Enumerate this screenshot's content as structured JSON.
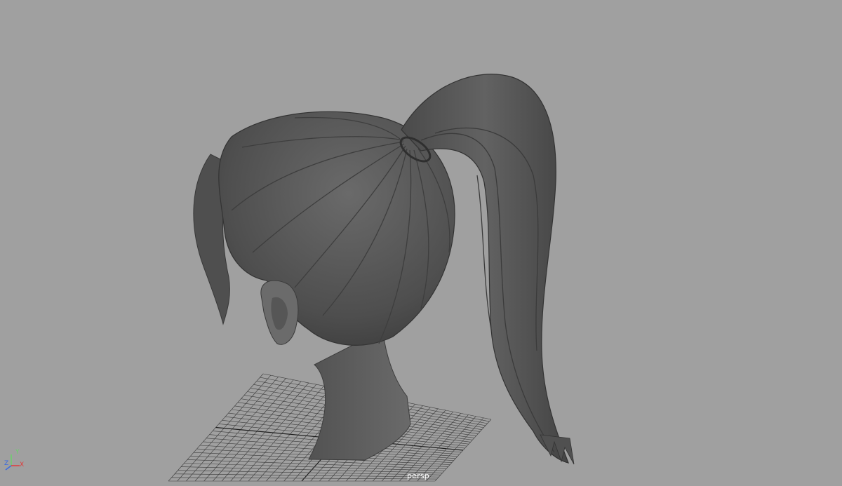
{
  "viewport": {
    "camera_name": "persp",
    "background_color": "#a0a0a0"
  },
  "axis_gizmo": {
    "x_label": "X",
    "y_label": "Y",
    "z_label": "Z",
    "x_color": "#e03a3a",
    "y_color": "#6ad16a",
    "z_color": "#3a6ae0"
  },
  "scene": {
    "objects": [
      "head-bust-mesh",
      "hair-mesh",
      "ponytail-mesh",
      "hair-tie-mesh",
      "ground-grid"
    ],
    "shading_color": "#5b5b5b"
  }
}
